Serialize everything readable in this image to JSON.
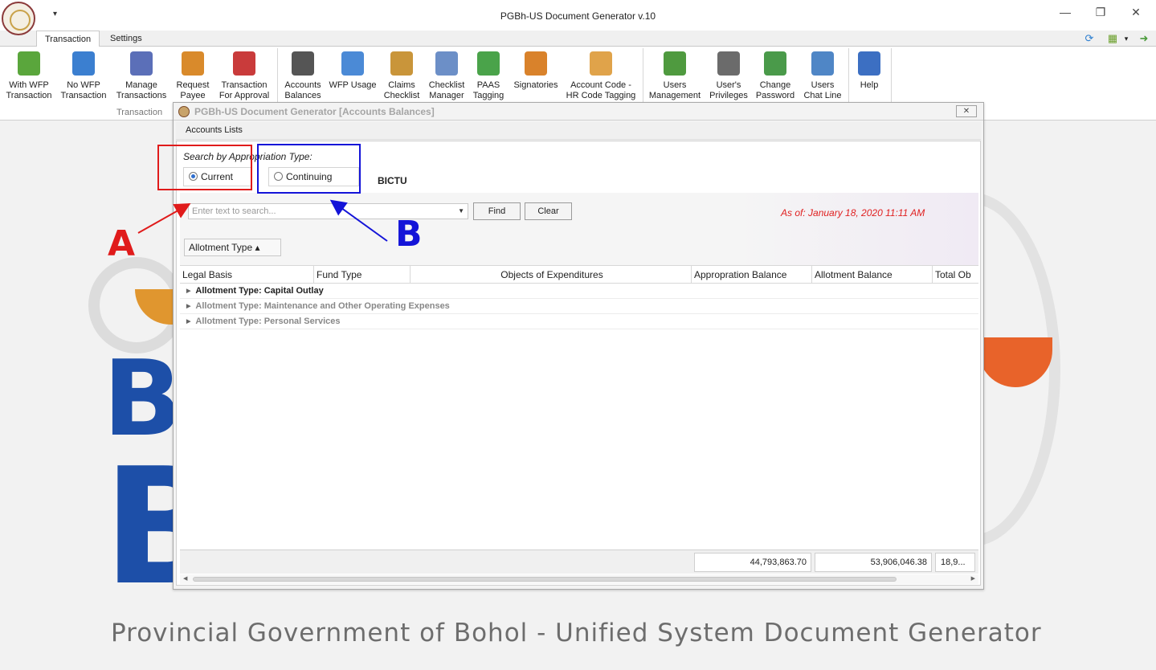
{
  "titlebar": {
    "title": "PGBh-US Document Generator v.10",
    "qat_arrow": "▾",
    "minimize": "—",
    "restore": "❐",
    "close": "✕"
  },
  "tabs": [
    {
      "label": "Transaction",
      "active": true
    },
    {
      "label": "Settings",
      "active": false
    }
  ],
  "ribbon": {
    "groups": [
      {
        "label": "Transaction"
      }
    ],
    "buttons": [
      {
        "label1": "With WFP",
        "label2": "Transaction",
        "icon": "add-document-icon",
        "color": "#5aa63c"
      },
      {
        "label1": "No WFP",
        "label2": "Transaction",
        "icon": "add-document-blue-icon",
        "color": "#3b7fd0"
      },
      {
        "label1": "Manage",
        "label2": "Transactions",
        "icon": "list-icon",
        "color": "#5b6fb8"
      },
      {
        "label1": "Request",
        "label2": "Payee",
        "icon": "user-arrow-icon",
        "color": "#d98a2b"
      },
      {
        "label1": "Transaction",
        "label2": "For Approval",
        "icon": "ab-icon",
        "color": "#c93b3b"
      },
      {
        "label1": "Accounts",
        "label2": "Balances",
        "icon": "book-icon",
        "color": "#555555"
      },
      {
        "label1": "WFP Usage",
        "label2": "",
        "icon": "magnifier-document-icon",
        "color": "#4b8ad6"
      },
      {
        "label1": "Claims",
        "label2": "Checklist",
        "icon": "clipboard-icon",
        "color": "#c9953a"
      },
      {
        "label1": "Checklist",
        "label2": "Manager",
        "icon": "checklist-icon",
        "color": "#6c8fc7"
      },
      {
        "label1": "PAAS",
        "label2": "Tagging",
        "icon": "refresh-green-icon",
        "color": "#4aa34a"
      },
      {
        "label1": "Signatories",
        "label2": "",
        "icon": "users-group-icon",
        "color": "#d9822b"
      },
      {
        "label1": "Account Code -",
        "label2": "HR Code Tagging",
        "icon": "tag-icon",
        "color": "#e0a34a"
      },
      {
        "label1": "Users",
        "label2": "Management",
        "icon": "users-management-icon",
        "color": "#4f9a3f"
      },
      {
        "label1": "User's",
        "label2": "Privileges",
        "icon": "user-gear-icon",
        "color": "#6b6b6b"
      },
      {
        "label1": "Change",
        "label2": "Password",
        "icon": "user-key-icon",
        "color": "#4a9a4a"
      },
      {
        "label1": "Users",
        "label2": "Chat Line",
        "icon": "chat-icon",
        "color": "#4f86c6"
      },
      {
        "label1": "Help",
        "label2": "",
        "icon": "help-icon",
        "color": "#3c6fc2"
      }
    ]
  },
  "background": {
    "footer": "Provincial Government of Bohol - Unified System Document Generator",
    "letter_top": "B",
    "letter_bottom": "B"
  },
  "child_window": {
    "title": "PGBh-US Document Generator [Accounts Balances]",
    "close": "✕",
    "menu": "Accounts Lists",
    "search_label": "Search by Appropriation Type:",
    "radio_current": "Current",
    "radio_continuing": "Continuing",
    "office": "BICTU",
    "search_placeholder": "Enter text to search...",
    "find": "Find",
    "clear": "Clear",
    "as_of": "As of: January 18, 2020 11:11 AM",
    "group_chip": "Allotment Type ▴",
    "columns": [
      "Legal Basis",
      "Fund Type",
      "Objects of Expenditures",
      "Appropration Balance",
      "Allotment Balance",
      "Total Ob"
    ],
    "groups": [
      "Allotment Type: Capital Outlay",
      "Allotment Type: Maintenance and Other Operating Expenses",
      "Allotment Type: Personal Services"
    ],
    "totals": [
      "44,793,863.70",
      "53,906,046.38",
      "18,9..."
    ]
  },
  "annotations": {
    "a": "A",
    "b": "B",
    "color_a": "#e01b1b",
    "color_b": "#1414d8"
  }
}
